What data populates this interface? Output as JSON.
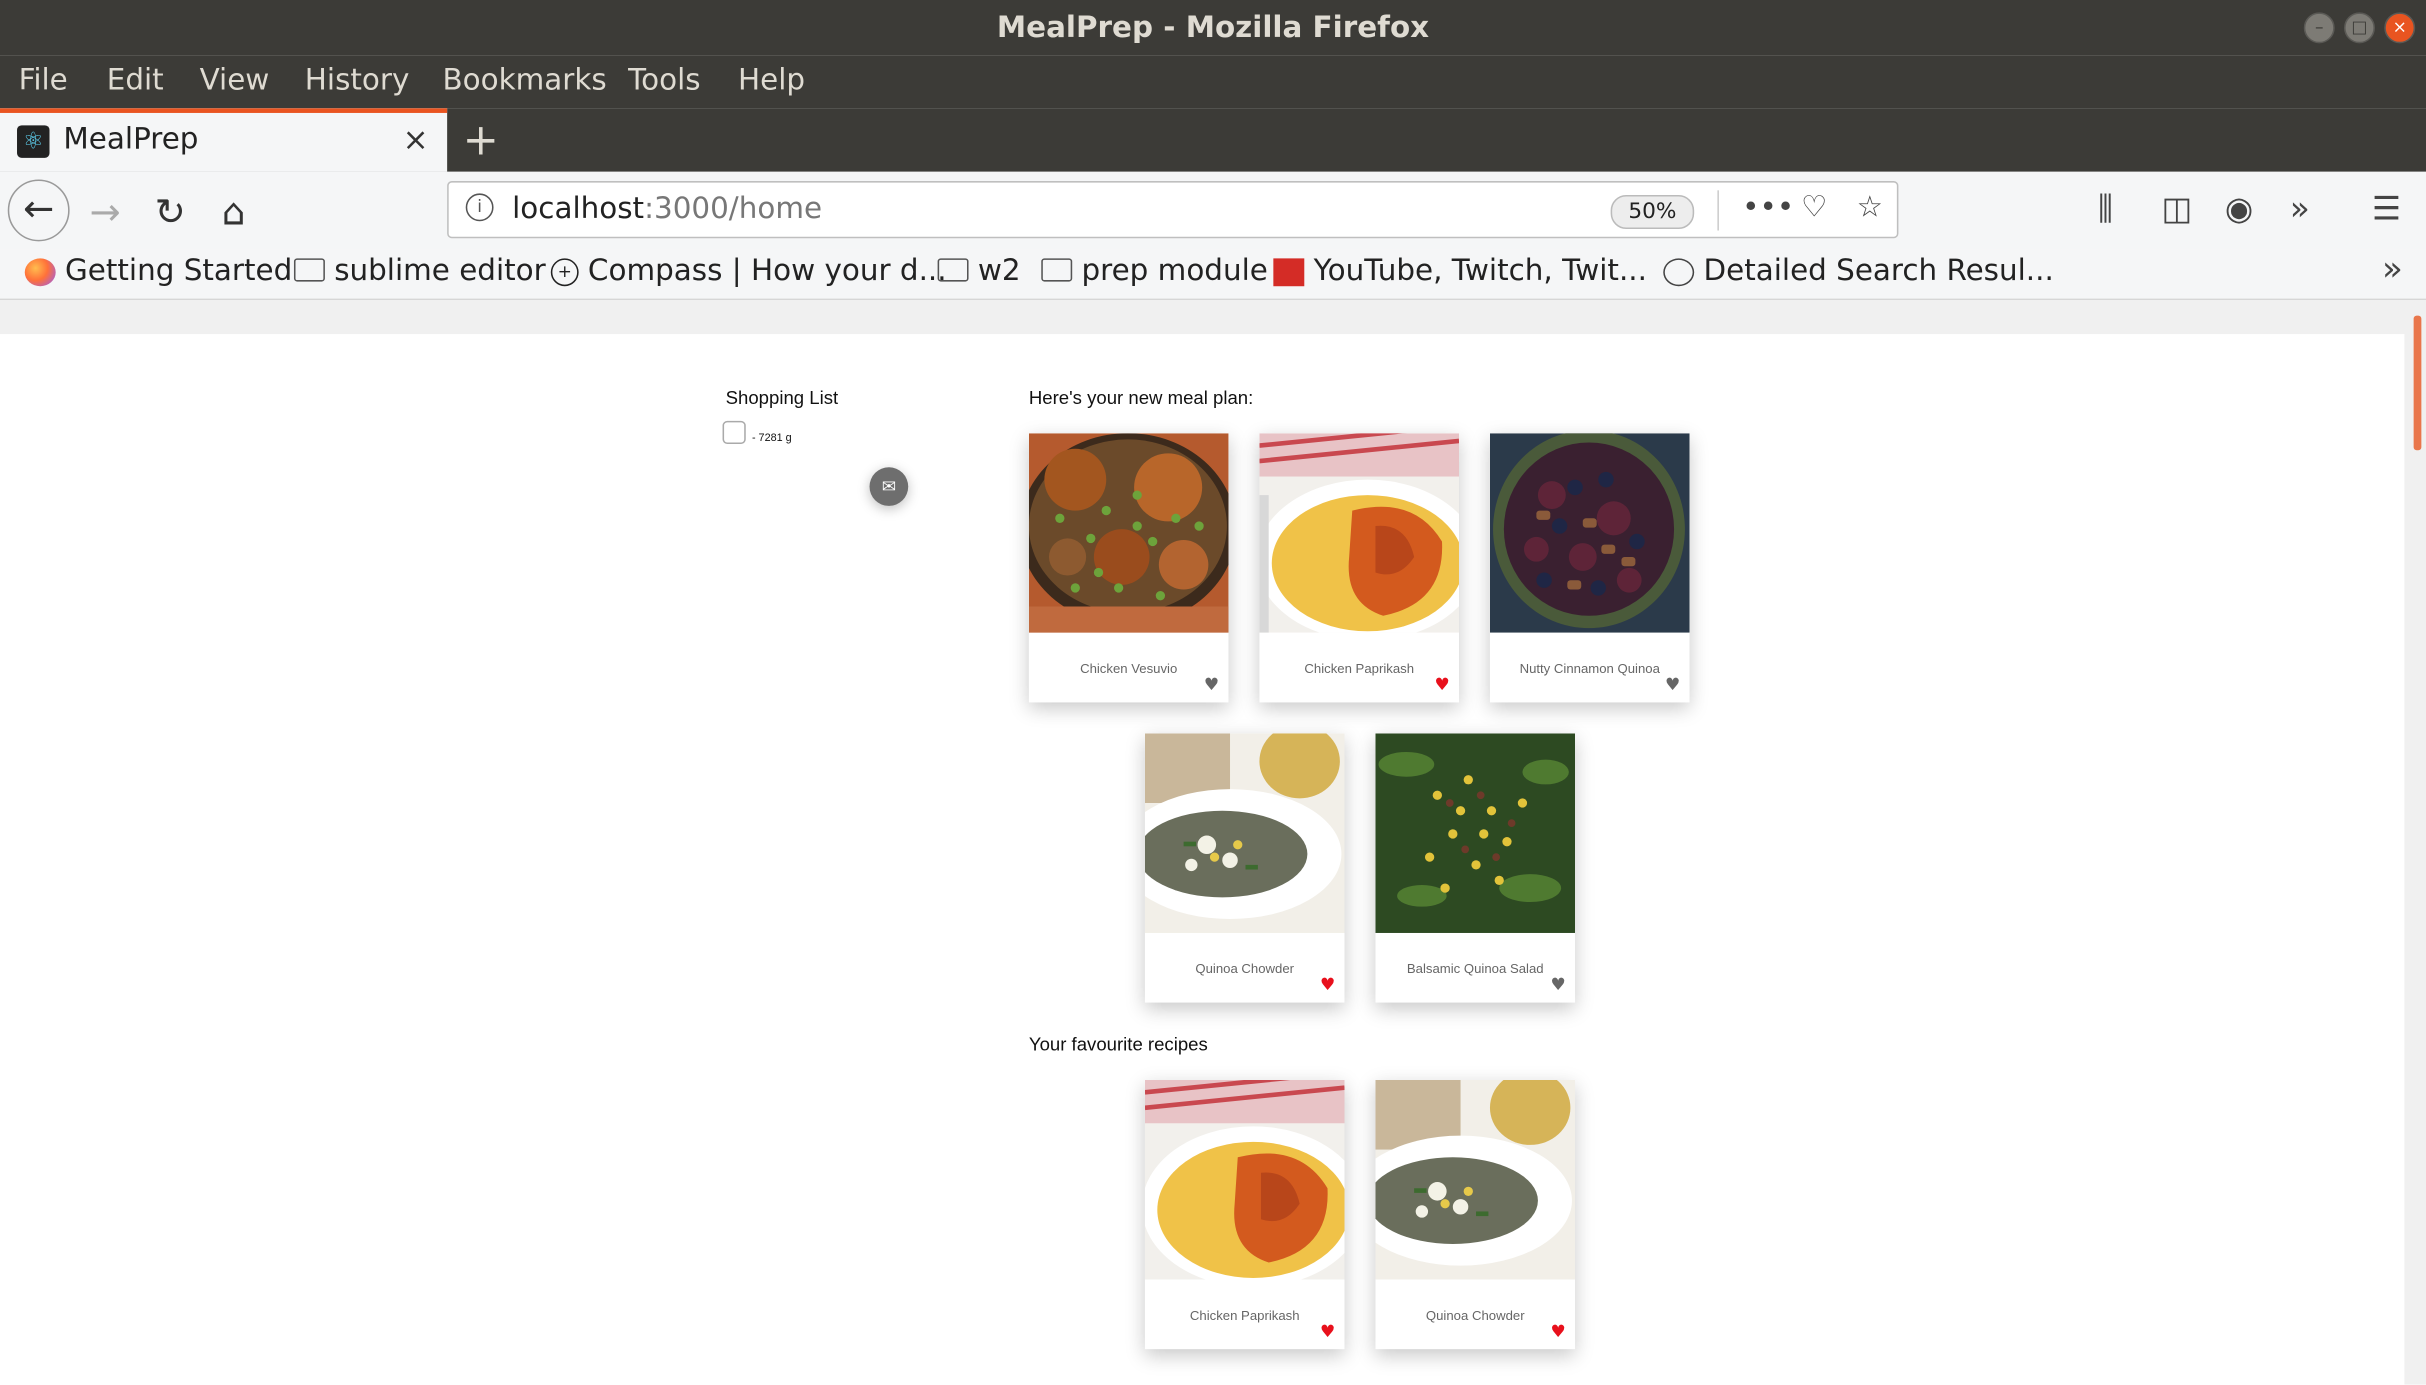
{
  "window": {
    "title": "MealPrep - Mozilla Firefox"
  },
  "menu": [
    "File",
    "Edit",
    "View",
    "History",
    "Bookmarks",
    "Tools",
    "Help"
  ],
  "tab": {
    "title": "MealPrep",
    "close": "×",
    "new_tab": "+"
  },
  "url": {
    "host": "localhost",
    "rest": ":3000/home",
    "zoom": "50%"
  },
  "bookmarks": [
    {
      "label": "Getting Started",
      "icon": "firefox-icon"
    },
    {
      "label": "sublime editor",
      "icon": "folder-icon"
    },
    {
      "label": "Compass | How your d...",
      "icon": "compass-icon"
    },
    {
      "label": "w2",
      "icon": "folder-icon"
    },
    {
      "label": "prep module",
      "icon": "folder-icon"
    },
    {
      "label": "YouTube, Twitch, Twit...",
      "icon": "chart-app-icon"
    },
    {
      "label": "Detailed Search Resul...",
      "icon": "globe-icon"
    }
  ],
  "shopping": {
    "title": "Shopping List",
    "item": "- 7281 g"
  },
  "meal_plan": {
    "heading": "Here's your new meal plan:",
    "recipes": [
      {
        "name": "Chicken Vesuvio",
        "favorite": false
      },
      {
        "name": "Chicken Paprikash",
        "favorite": true
      },
      {
        "name": "Nutty Cinnamon Quinoa",
        "favorite": false
      },
      {
        "name": "Quinoa Chowder",
        "favorite": true
      },
      {
        "name": "Balsamic Quinoa Salad",
        "favorite": false
      }
    ]
  },
  "favourites": {
    "heading": "Your favourite recipes",
    "recipes": [
      {
        "name": "Chicken Paprikash",
        "favorite": true
      },
      {
        "name": "Quinoa Chowder",
        "favorite": true
      }
    ]
  },
  "colors": {
    "accent": "#e95420",
    "heart_on": "#e8101c",
    "heart_off": "#666666"
  }
}
